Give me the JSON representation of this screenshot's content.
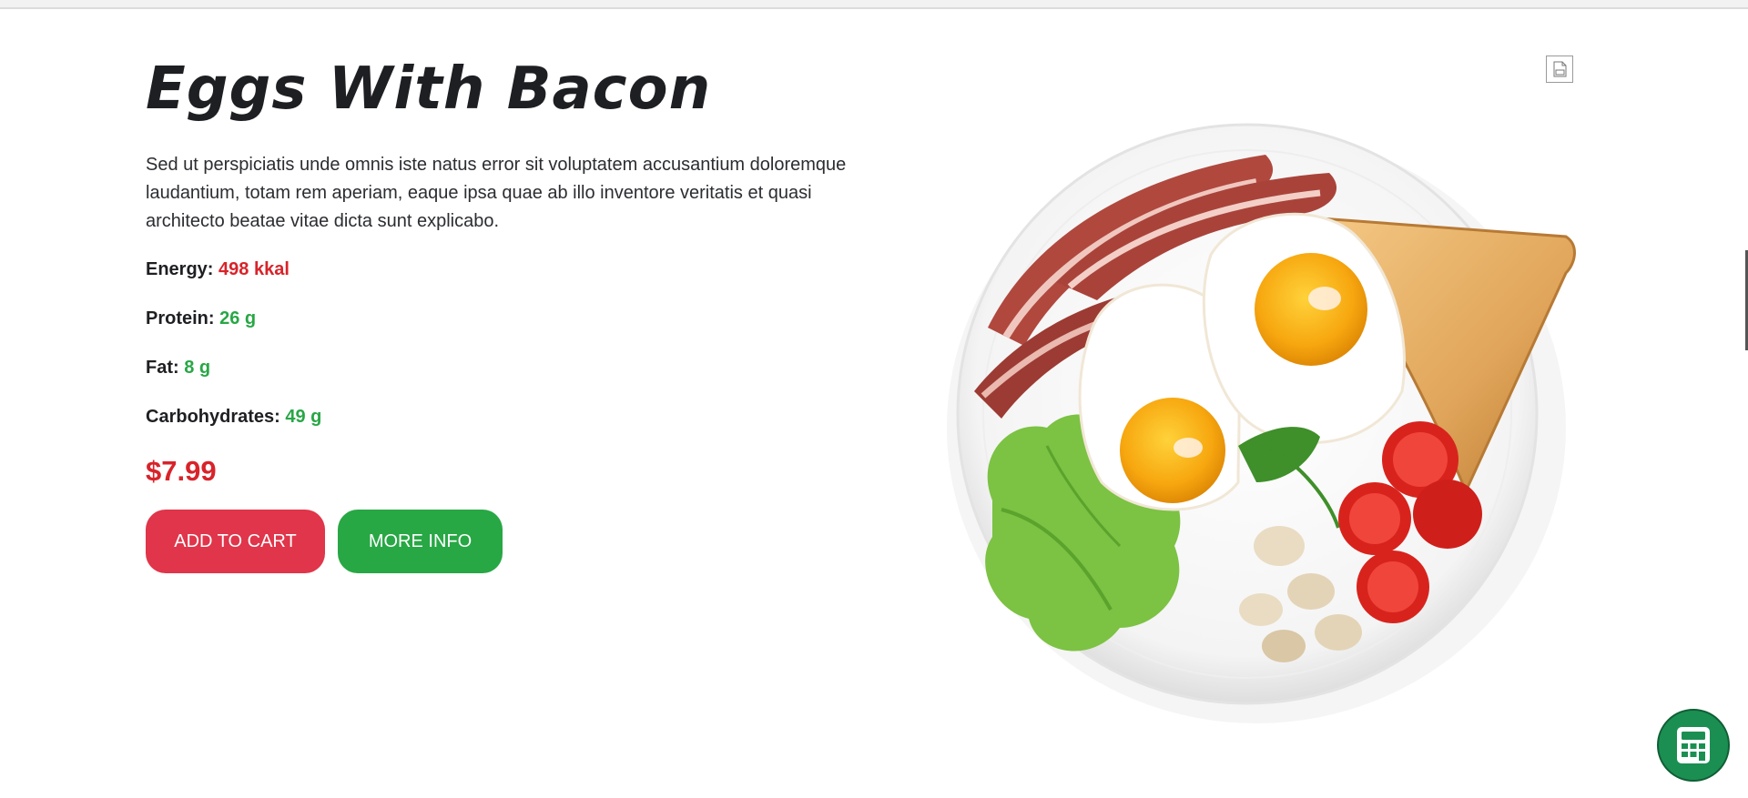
{
  "product": {
    "title": "Eggs With Bacon",
    "description": "Sed ut perspiciatis unde omnis iste natus error sit voluptatem accusantium doloremque laudantium, totam rem aperiam, eaque ipsa quae ab illo inventore veritatis et quasi architecto beatae vitae dicta sunt explicabo.",
    "nutrition": [
      {
        "label": "Energy:",
        "value": "498 kkal",
        "color": "#d8232a"
      },
      {
        "label": "Protein:",
        "value": "26 g",
        "color": "#28a745"
      },
      {
        "label": "Fat:",
        "value": "8 g",
        "color": "#28a745"
      },
      {
        "label": "Carbohydrates:",
        "value": "49 g",
        "color": "#28a745"
      }
    ],
    "price": "$7.99"
  },
  "actions": {
    "add_to_cart": "ADD TO CART",
    "more_info": "MORE INFO"
  },
  "icons": {
    "broken_image": "broken-image-icon",
    "calculator": "calculator-icon"
  },
  "colors": {
    "accent_red": "#e0354a",
    "accent_green": "#28a745",
    "price_red": "#d8232a",
    "calculator_bg": "#1b8f52"
  }
}
